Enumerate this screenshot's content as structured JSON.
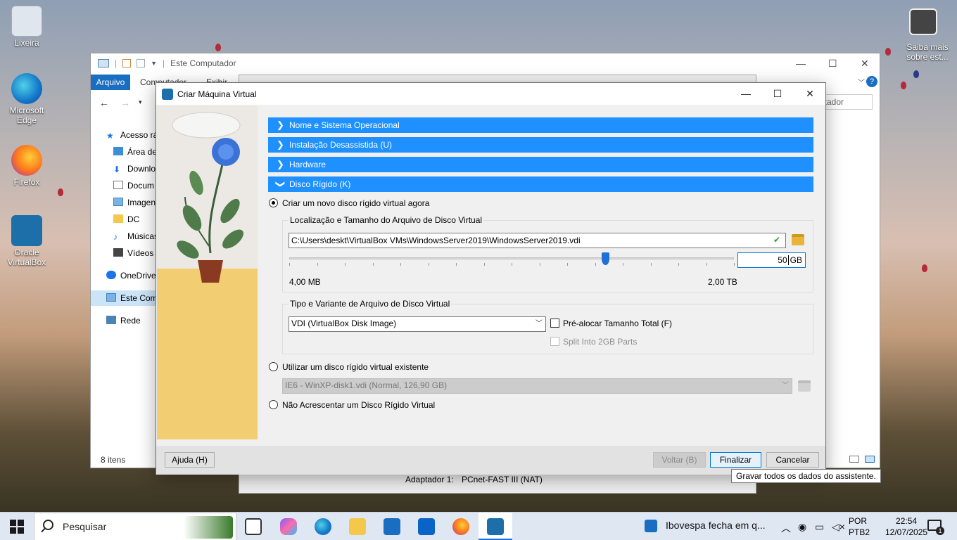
{
  "desktop": {
    "icons": [
      {
        "label": "Lixeira"
      },
      {
        "label": "Microsoft Edge"
      },
      {
        "label": "Firefox"
      },
      {
        "label": "Oracle VirtualBox"
      }
    ],
    "spotlight_label": "Saiba mais sobre est..."
  },
  "explorer": {
    "title": "Este Computador",
    "ribbon_file": "Arquivo",
    "ribbon_tabs": [
      "Computador",
      "Exibir"
    ],
    "search_placeholder": "utador",
    "nav": [
      "Acesso rá",
      "Área de",
      "Downlo",
      "Docum",
      "Imagen",
      "DC",
      "Músicas",
      "Vídeos",
      "OneDrive",
      "Este Com",
      "Rede"
    ],
    "status": "8 itens"
  },
  "vbox_back": {
    "adapter_label": "Adaptador 1:",
    "adapter_value": "PCnet-FAST III (NAT)"
  },
  "dialog": {
    "title": "Criar Máquina Virtual",
    "sections": [
      {
        "label": "Nome e Sistema Operacional",
        "expanded": false
      },
      {
        "label": "Instalação Desassistida (U)",
        "expanded": false
      },
      {
        "label": "Hardware",
        "expanded": false
      },
      {
        "label": "Disco Rígido (K)",
        "expanded": true
      }
    ],
    "create_new_label": "Criar um novo disco rígido virtual agora",
    "location_group_label": "Localização e Tamanho do Arquivo de Disco Virtual",
    "file_path": "C:\\Users\\deskt\\VirtualBox VMs\\WindowsServer2019\\WindowsServer2019.vdi",
    "size_value": "50",
    "size_unit": "GB",
    "slider_fraction": 0.71,
    "slider_min": "4,00 MB",
    "slider_max": "2,00 TB",
    "type_group_label": "Tipo e Variante de Arquivo de Disco Virtual",
    "disk_type": "VDI (VirtualBox Disk Image)",
    "prealloc_label": "Pré-alocar Tamanho Total (F)",
    "split_label": "Split Into 2GB Parts",
    "use_existing_label": "Utilizar um disco rígido virtual existente",
    "existing_disk": "IE6 - WinXP-disk1.vdi (Normal, 126,90 GB)",
    "no_disk_label": "Não Acrescentar um Disco Rígido Virtual",
    "buttons": {
      "help": "Ajuda (H)",
      "back": "Voltar (B)",
      "finish": "Finalizar",
      "cancel": "Cancelar"
    },
    "tooltip": "Gravar todos os dados do assistente."
  },
  "taskbar": {
    "search_placeholder": "Pesquisar",
    "news": "Ibovespa fecha em q...",
    "lang1": "POR",
    "lang2": "PTB2",
    "time": "22:54",
    "date": "12/07/2025",
    "notif_count": "1"
  },
  "colors": {
    "section_header": "#1e90ff",
    "accent": "#0078d7"
  }
}
